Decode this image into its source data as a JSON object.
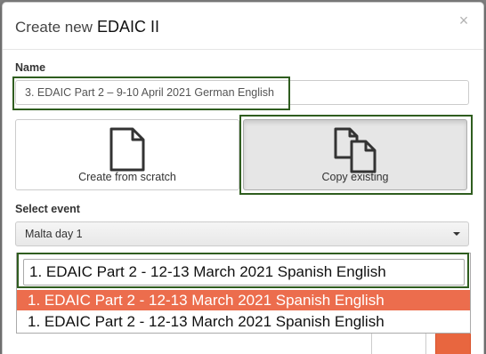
{
  "modal": {
    "title_prefix": "Create new",
    "title_strong": "EDAIC II",
    "close_glyph": "×"
  },
  "name_field": {
    "label": "Name",
    "value": "3. EDAIC Part 2 – 9-10 April 2021 German English"
  },
  "choices": [
    {
      "label": "Create from scratch",
      "icon": "blank-document-icon",
      "active": false
    },
    {
      "label": "Copy existing",
      "icon": "copy-documents-icon",
      "active": true
    }
  ],
  "event_select": {
    "label": "Select event",
    "value": "Malta day 1"
  },
  "dropdown": {
    "search_value": "1. EDAIC Part 2 - 12-13 March 2021 Spanish English",
    "options": [
      "1. EDAIC Part 2 - 12-13 March 2021 Spanish English",
      "1. EDAIC Part 2 - 12-13 March 2021 Spanish English"
    ]
  },
  "colors": {
    "highlight_border": "#2f5d1f",
    "selected_option_bg": "#ec6d4d",
    "footer_primary": "#e8663f"
  }
}
